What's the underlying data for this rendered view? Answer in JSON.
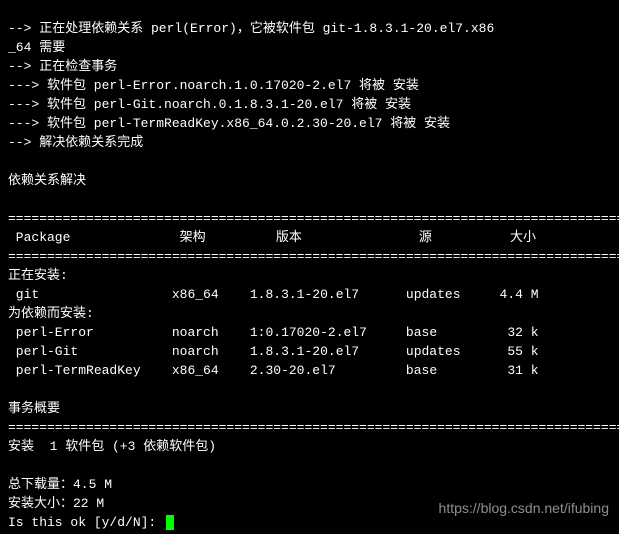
{
  "log": {
    "l1": "--> 正在处理依赖关系 perl(Error)，它被软件包 git-1.8.3.1-20.el7.x86",
    "l2": "_64 需要",
    "l3": "--> 正在检查事务",
    "l4": "---> 软件包 perl-Error.noarch.1.0.17020-2.el7 将被 安装",
    "l5": "---> 软件包 perl-Git.noarch.0.1.8.3.1-20.el7 将被 安装",
    "l6": "---> 软件包 perl-TermReadKey.x86_64.0.2.30-20.el7 将被 安装",
    "l7": "--> 解决依赖关系完成"
  },
  "resolved": "依赖关系解决",
  "divider": "================================================================================",
  "header": {
    "pkg": " Package",
    "arch": "架构",
    "ver": "版本",
    "repo": "源",
    "size": "大小"
  },
  "section_install": "正在安装:",
  "section_deps": "为依赖而安装:",
  "rows": {
    "git": {
      "name": " git",
      "arch": "x86_64",
      "ver": "1.8.3.1-20.el7",
      "repo": "updates",
      "size": "4.4 M"
    },
    "err": {
      "name": " perl-Error",
      "arch": "noarch",
      "ver": "1:0.17020-2.el7",
      "repo": "base",
      "size": " 32 k"
    },
    "pgit": {
      "name": " perl-Git",
      "arch": "noarch",
      "ver": "1.8.3.1-20.el7",
      "repo": "updates",
      "size": " 55 k"
    },
    "trk": {
      "name": " perl-TermReadKey",
      "arch": "x86_64",
      "ver": "2.30-20.el7",
      "repo": "base",
      "size": " 31 k"
    }
  },
  "summary_title": "事务概要",
  "install_line": "安装  1 软件包 (+3 依赖软件包)",
  "total_dl": "总下载量：4.5 M",
  "install_size": "安装大小：22 M",
  "prompt": "Is this ok [y/d/N]: ",
  "watermark": "https://blog.csdn.net/ifubing"
}
